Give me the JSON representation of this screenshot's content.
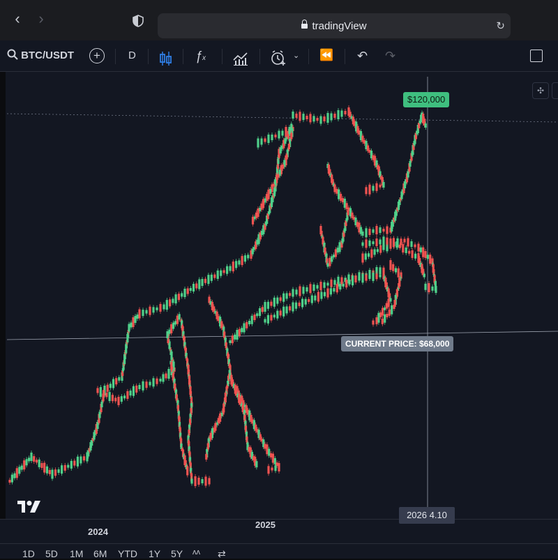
{
  "browser": {
    "url": "tradingView",
    "icons": [
      "back-arrow-icon",
      "forward-arrow-icon",
      "shield-icon",
      "lock-icon",
      "reload-icon"
    ]
  },
  "toolbar": {
    "symbol": "BTC/USDT",
    "interval": "D",
    "icons": [
      "search-icon",
      "add-symbol-icon",
      "candles-icon",
      "indicators-icon",
      "templates-icon",
      "alert-icon",
      "replay-icon",
      "undo-icon",
      "redo-icon",
      "fullscreen-icon"
    ]
  },
  "chart": {
    "top_price_label": "$120,000",
    "current_price_label": "CURRENT PRICE: $68,000",
    "years": [
      "2024",
      "2025"
    ],
    "crosshair_date": "2026 4.10",
    "colors": {
      "up": "#4fd08a",
      "down": "#ef5350",
      "background": "#131722",
      "crosshair": "#9aa0ad"
    }
  },
  "ranges": [
    "1D",
    "5D",
    "1M",
    "6M",
    "YTD",
    "1Y",
    "5Y"
  ]
}
